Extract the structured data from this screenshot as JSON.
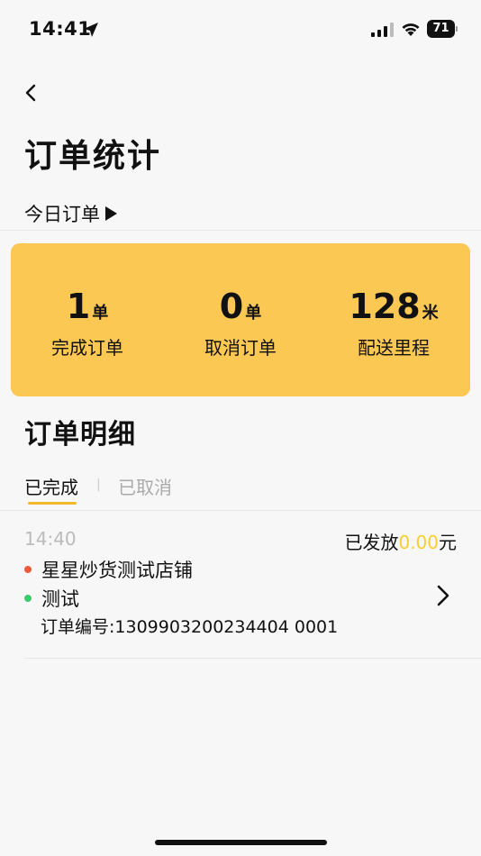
{
  "status_bar": {
    "time": "14:41",
    "battery_level": "71"
  },
  "header": {
    "title": "订单统计",
    "date_filter_label": "今日订单"
  },
  "summary": {
    "completed": {
      "value": "1",
      "unit": "单",
      "label": "完成订单"
    },
    "cancelled": {
      "value": "0",
      "unit": "单",
      "label": "取消订单"
    },
    "distance": {
      "value": "128",
      "unit": "米",
      "label": "配送里程"
    }
  },
  "details": {
    "title": "订单明细",
    "tabs": [
      {
        "label": "已完成",
        "active": true
      },
      {
        "label": "已取消",
        "active": false
      }
    ],
    "tab_separator": "|"
  },
  "orders": [
    {
      "time": "14:40",
      "amount_prefix": "已发放",
      "amount_value": "0.00",
      "amount_suffix": "元",
      "store": "星星炒货测试店铺",
      "customer": "测试",
      "order_no": "订单编号:1309903200234404 0001"
    }
  ],
  "colors": {
    "accent": "#fbc853",
    "amount": "#f8cf2e",
    "store_dot": "#f15a3a",
    "customer_dot": "#3ecb6d"
  }
}
